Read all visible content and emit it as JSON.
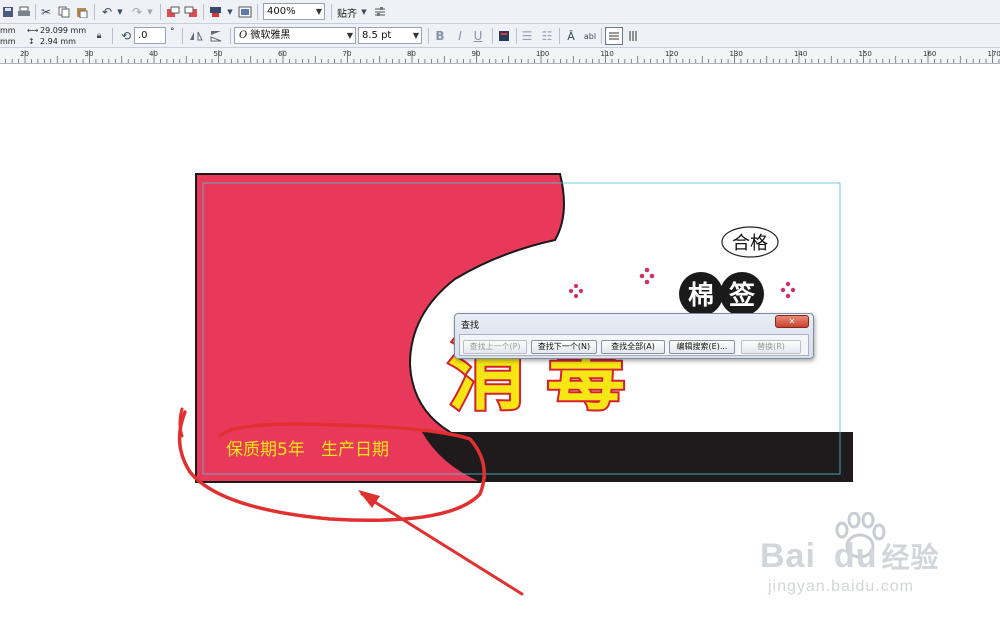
{
  "toolbar": {
    "zoom": "400%",
    "snap_label": "贴齐"
  },
  "property_bar": {
    "unit_x": "mm",
    "unit_y": "mm",
    "width": "29.099 mm",
    "height": "2.94 mm",
    "rotation": ".0",
    "degree_symbol": "°",
    "font_name": "微软雅黑",
    "font_size": "8.5 pt",
    "text_tool_label": "abl"
  },
  "ruler": {
    "ticks": [
      "20",
      "30",
      "40",
      "50",
      "60",
      "70",
      "80",
      "90",
      "100",
      "110",
      "120",
      "130",
      "140",
      "150",
      "160",
      "170"
    ]
  },
  "design": {
    "qualified_label": "合格",
    "product_line1": "棉",
    "product_line2": "签",
    "title_char1": "消",
    "title_char2": "毒",
    "bottom_text": "保质期5年   生产日期"
  },
  "find_dialog": {
    "title": "查找",
    "close_symbol": "✕",
    "buttons": {
      "find_prev": "查找上一个(P)",
      "find_next": "查找下一个(N)",
      "find_all": "查找全部(A)",
      "edit_search": "编辑搜索(E)...",
      "replace": "替换(R)"
    }
  },
  "watermark": {
    "brand_latin": "Bai",
    "brand_du": "du",
    "brand_cn": "经验",
    "url": "jingyan.baidu.com"
  },
  "colors": {
    "label_red": "#e8395a",
    "black_band": "#1f1b1c",
    "title_yellow": "#f5e614",
    "annotation_red": "#e03030",
    "guide_cyan": "#4fc3d8"
  }
}
